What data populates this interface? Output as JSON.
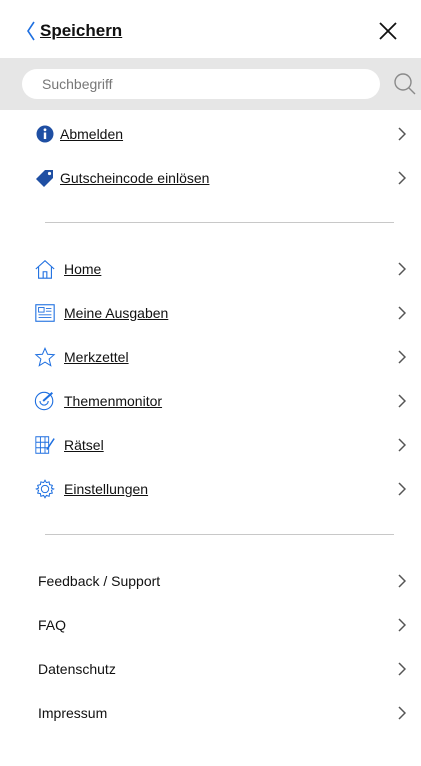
{
  "header": {
    "back_label": "Speichern"
  },
  "search": {
    "placeholder": "Suchbegriff"
  },
  "account_items": [
    {
      "label": "Abmelden",
      "icon": "info-icon"
    },
    {
      "label": "Gutscheincode einlösen",
      "icon": "tag-icon"
    }
  ],
  "nav_items": [
    {
      "label": "Home",
      "icon": "home-icon"
    },
    {
      "label": "Meine Ausgaben",
      "icon": "newspaper-icon"
    },
    {
      "label": "Merkzettel",
      "icon": "star-icon"
    },
    {
      "label": "Themenmonitor",
      "icon": "monitor-icon"
    },
    {
      "label": "Rätsel",
      "icon": "puzzle-icon"
    },
    {
      "label": "Einstellungen",
      "icon": "gear-icon"
    }
  ],
  "info_items": [
    {
      "label": "Feedback / Support"
    },
    {
      "label": "FAQ"
    },
    {
      "label": "Datenschutz"
    },
    {
      "label": "Impressum"
    }
  ],
  "colors": {
    "accent": "#1e6fe0",
    "icon_blue": "#1f4fa3",
    "search_bar_bg": "#e6e6e6"
  }
}
